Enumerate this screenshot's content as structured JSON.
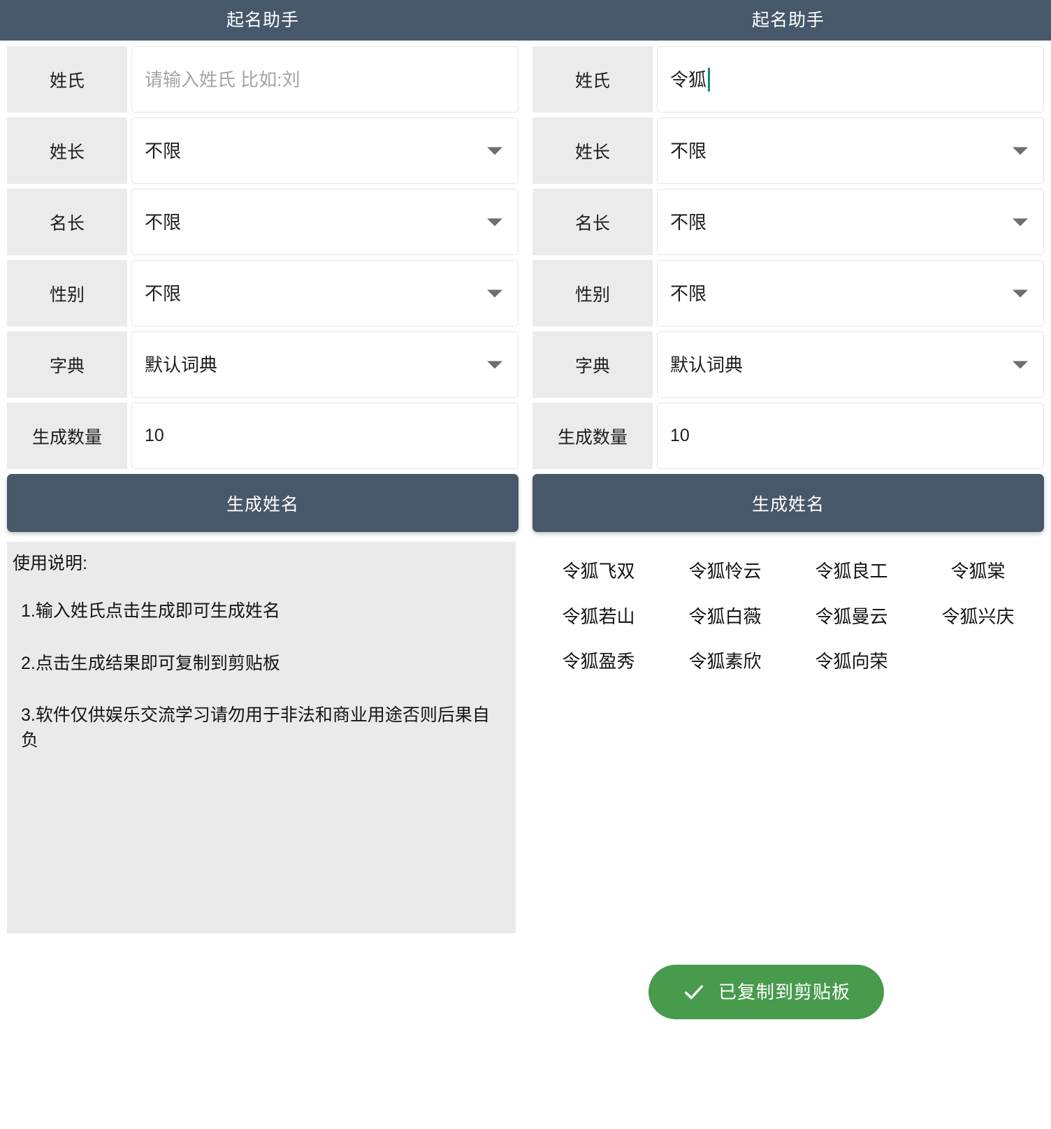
{
  "app": {
    "title": "起名助手",
    "accent_dark": "#46586a",
    "label_bg": "#ebebeb",
    "toast_green": "#489a4d",
    "caret_green": "#17857a"
  },
  "panels": [
    {
      "id": "left",
      "title": "起名助手",
      "fields": [
        {
          "label": "姓氏",
          "value": "",
          "placeholder": "请输入姓氏 比如:刘",
          "type": "text",
          "has_caret": false
        },
        {
          "label": "姓长",
          "value": "不限",
          "type": "select"
        },
        {
          "label": "名长",
          "value": "不限",
          "type": "select"
        },
        {
          "label": "性别",
          "value": "不限",
          "type": "select"
        },
        {
          "label": "字典",
          "value": "默认词典",
          "type": "select"
        },
        {
          "label": "生成数量",
          "value": "10",
          "type": "number"
        }
      ],
      "generate_button": "生成姓名",
      "help": {
        "title": "使用说明:",
        "items": [
          "1.输入姓氏点击生成即可生成姓名",
          "2.点击生成结果即可复制到剪贴板",
          "3.软件仅供娱乐交流学习请勿用于非法和商业用途否则后果自负"
        ]
      },
      "results": []
    },
    {
      "id": "right",
      "title": "起名助手",
      "fields": [
        {
          "label": "姓氏",
          "value": "令狐",
          "placeholder": "请输入姓氏 比如:刘",
          "type": "text",
          "has_caret": true
        },
        {
          "label": "姓长",
          "value": "不限",
          "type": "select"
        },
        {
          "label": "名长",
          "value": "不限",
          "type": "select"
        },
        {
          "label": "性别",
          "value": "不限",
          "type": "select"
        },
        {
          "label": "字典",
          "value": "默认词典",
          "type": "select"
        },
        {
          "label": "生成数量",
          "value": "10",
          "type": "number"
        }
      ],
      "generate_button": "生成姓名",
      "help": null,
      "results": [
        "令狐飞双",
        "令狐怜云",
        "令狐良工",
        "令狐棠",
        "令狐若山",
        "令狐白薇",
        "令狐曼云",
        "令狐兴庆",
        "令狐盈秀",
        "令狐素欣",
        "令狐向荣"
      ]
    }
  ],
  "toast": {
    "message": "已复制到剪贴板",
    "icon": "check-icon"
  }
}
